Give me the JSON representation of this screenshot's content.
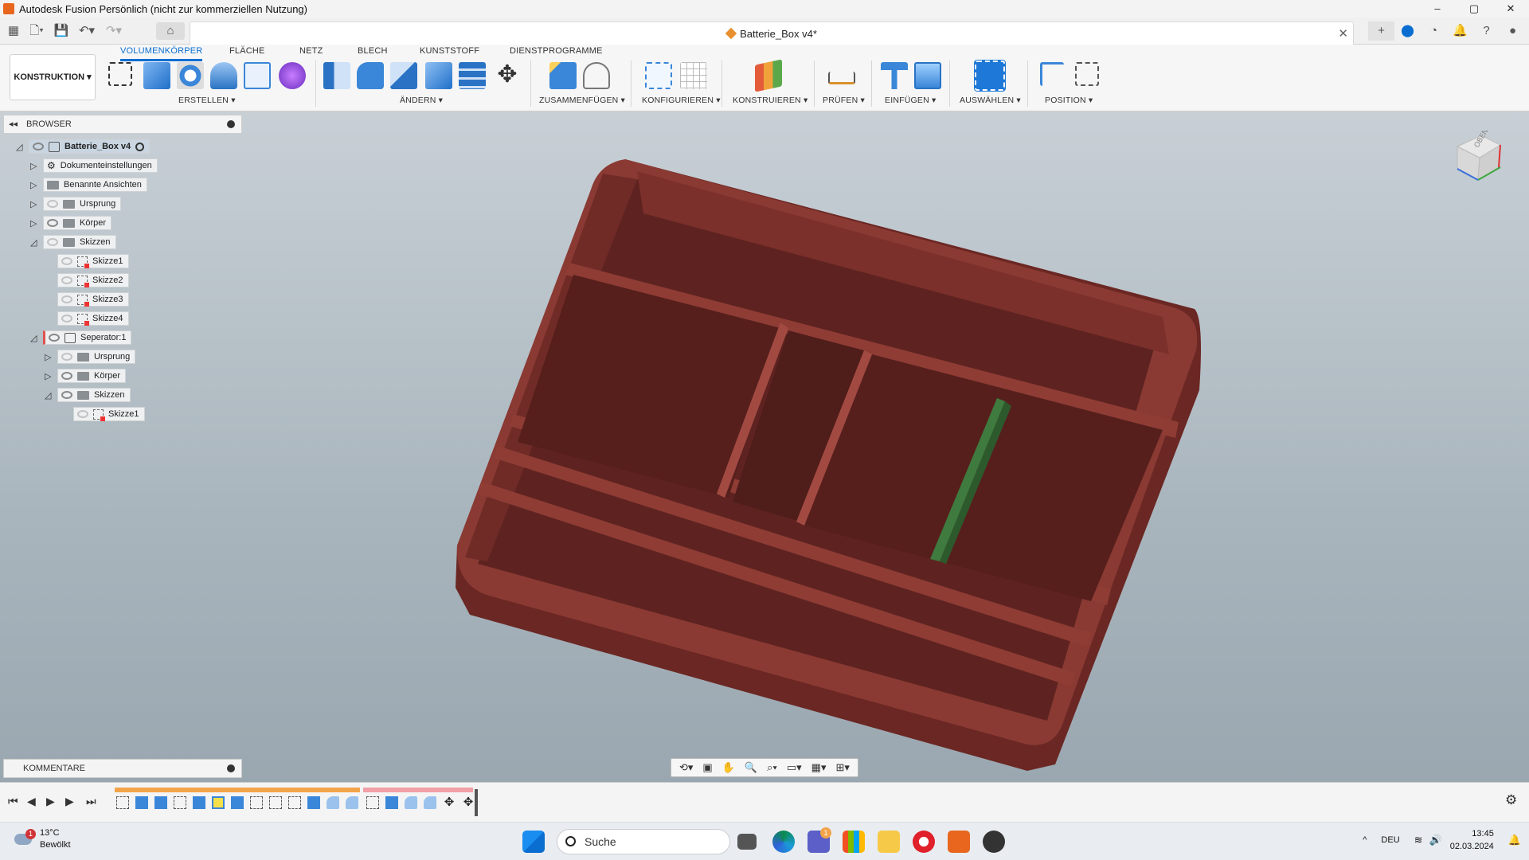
{
  "titlebar": {
    "title": "Autodesk Fusion Persönlich (nicht zur kommerziellen Nutzung)",
    "minimize": "–",
    "maximize": "▢",
    "close": "✕"
  },
  "doc": {
    "name": "Batterie_Box v4*",
    "close": "✕"
  },
  "ribbon": {
    "tabs": [
      "VOLUMENKÖRPER",
      "FLÄCHE",
      "NETZ",
      "BLECH",
      "KUNSTSTOFF",
      "DIENSTPROGRAMME"
    ],
    "workspace": "KONSTRUKTION ▾",
    "groups": {
      "erstellen": "ERSTELLEN ▾",
      "aendern": "ÄNDERN ▾",
      "zusammen": "ZUSAMMENFÜGEN ▾",
      "konfig": "KONFIGURIEREN ▾",
      "konstruieren": "KONSTRUIEREN ▾",
      "pruefen": "PRÜFEN ▾",
      "einfuegen": "EINFÜGEN ▾",
      "auswaehlen": "AUSWÄHLEN ▾",
      "position": "POSITION ▾"
    }
  },
  "browser": {
    "title": "BROWSER",
    "nodes": [
      {
        "label": "Batterie_Box v4"
      },
      {
        "label": "Dokumenteinstellungen"
      },
      {
        "label": "Benannte Ansichten"
      },
      {
        "label": "Ursprung"
      },
      {
        "label": "Körper"
      },
      {
        "label": "Skizzen"
      },
      {
        "label": "Skizze1"
      },
      {
        "label": "Skizze2"
      },
      {
        "label": "Skizze3"
      },
      {
        "label": "Skizze4"
      },
      {
        "label": "Seperator:1"
      },
      {
        "label": "Ursprung"
      },
      {
        "label": "Körper"
      },
      {
        "label": "Skizzen"
      },
      {
        "label": "Skizze1"
      }
    ]
  },
  "comments": {
    "title": "KOMMENTARE"
  },
  "viewcube": {
    "face": "OBEN"
  },
  "colors": {
    "accent": "#0a6ed1",
    "body": "#7a2e2a",
    "separator": "#3f7a3f"
  },
  "taskbar": {
    "weather": {
      "temp": "13°C",
      "desc": "Bewölkt",
      "badge": "1"
    },
    "search": "Suche",
    "teams_badge": "1",
    "lang": "DEU",
    "time": "13:45",
    "date": "02.03.2024"
  }
}
